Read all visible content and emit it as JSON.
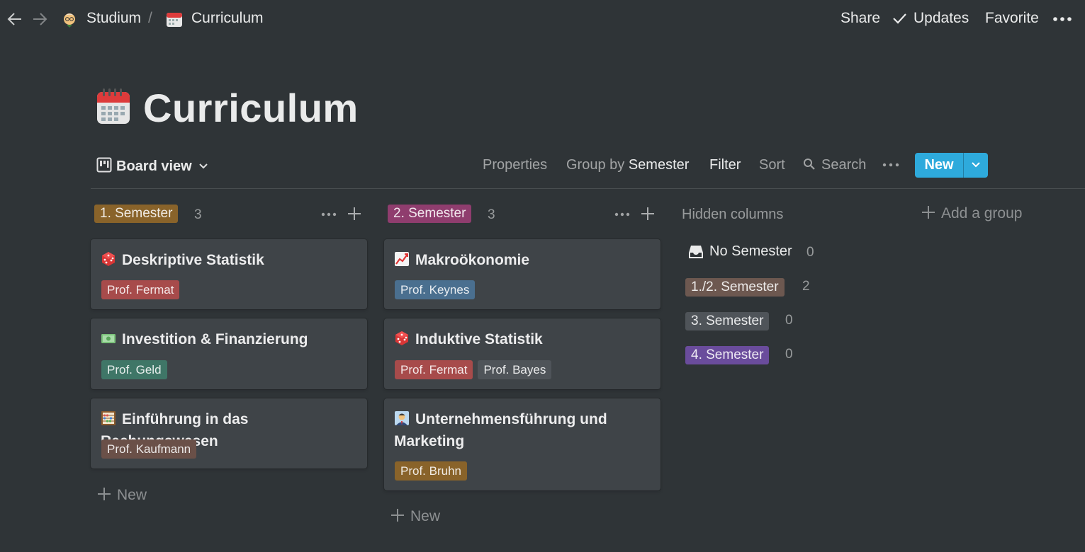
{
  "topbar": {
    "breadcrumbs": [
      "Studium",
      "/",
      "Curriculum"
    ],
    "actions": [
      "Share",
      "Updates",
      "Favorite"
    ]
  },
  "page": {
    "title": "Curriculum"
  },
  "viewbar": {
    "view_label": "Board view",
    "properties": "Properties",
    "group_by_prefix": "Group by",
    "group_by_value": "Semester",
    "filter": "Filter",
    "sort": "Sort",
    "search": "Search",
    "new_label": "New"
  },
  "columns": [
    {
      "label": "1. Semester",
      "count": "3",
      "cards": [
        {
          "title": "Deskriptive Statistik",
          "icon": "dice-icon",
          "tags": [
            "Prof. Fermat"
          ]
        },
        {
          "title": "Investition & Finanzierung",
          "icon": "money-icon",
          "tags": [
            "Prof. Geld"
          ]
        },
        {
          "title": "Einführung in das Rechungswesen",
          "icon": "abacus-icon",
          "tags": [
            "Prof. Kaufmann"
          ]
        }
      ],
      "new_label": "New"
    },
    {
      "label": "2. Semester",
      "count": "3",
      "cards": [
        {
          "title": "Makroökonomie",
          "icon": "chart-increasing-icon",
          "tags": [
            "Prof. Keynes"
          ]
        },
        {
          "title": "Induktive Statistik",
          "icon": "dice-icon",
          "tags": [
            "Prof. Fermat",
            "Prof. Bayes"
          ]
        },
        {
          "title": "Unternehmensführung und Marketing",
          "icon": "businessman-icon",
          "tags": [
            "Prof. Bruhn"
          ]
        }
      ],
      "new_label": "New"
    }
  ],
  "hidden": {
    "title": "Hidden columns",
    "groups": [
      {
        "label": "No Semester",
        "count": "0"
      },
      {
        "label": "1./2. Semester",
        "count": "2"
      },
      {
        "label": "3. Semester",
        "count": "0"
      },
      {
        "label": "4. Semester",
        "count": "0"
      }
    ]
  },
  "add_group": "Add a group",
  "colors": {
    "background": "#2f3437",
    "card": "#3f4448",
    "accent": "#2eaadc"
  }
}
